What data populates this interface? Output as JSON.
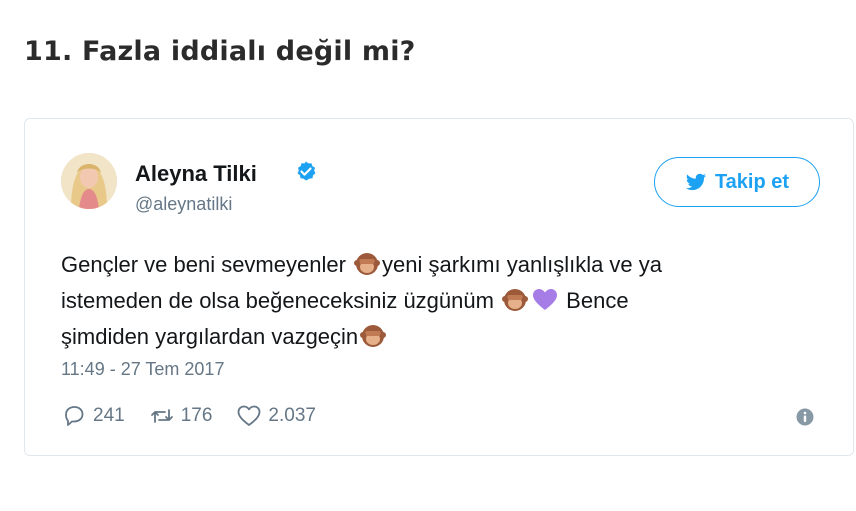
{
  "heading": "11. Fazla iddialı değil mi?",
  "tweet": {
    "display_name": "Aleyna Tilki",
    "handle": "@aleynatilki",
    "follow_label": "Takip et",
    "text_parts": {
      "l1a": "Gençler ve beni sevmeyenler ",
      "l1b": "yeni şarkımı yanlışlıkla ve ya",
      "l2a": "istemeden de olsa beğeneceksiniz üzgünüm ",
      "l2b": " Bence",
      "l3a": "şimdiden yargılardan vazgeçin"
    },
    "emojis": [
      "see-no-evil-monkey",
      "see-no-evil-monkey",
      "purple-heart",
      "see-no-evil-monkey"
    ],
    "timestamp": "11:49 - 27 Tem 2017",
    "replies": "241",
    "retweets": "176",
    "likes": "2.037"
  },
  "colors": {
    "twitter_blue": "#1da1f2",
    "muted": "#657786",
    "purple_heart": "#a67ce6"
  }
}
